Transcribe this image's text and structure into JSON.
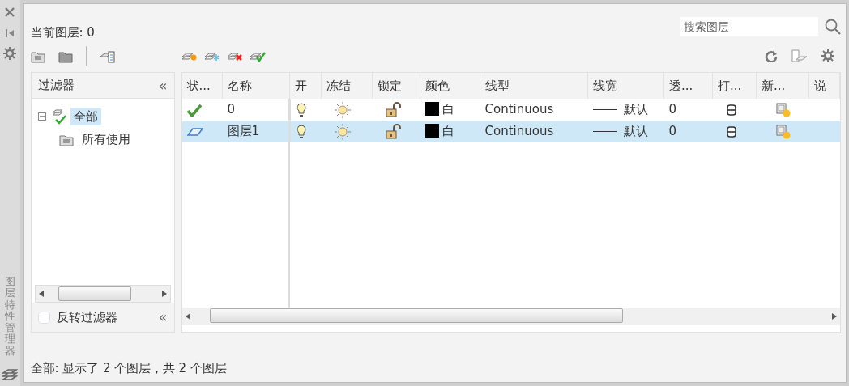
{
  "side_title": "图层特性管理器",
  "header": {
    "current_layer": "当前图层: 0"
  },
  "search": {
    "placeholder": "搜索图层"
  },
  "filter_panel": {
    "title": "过滤器",
    "collapse": "«",
    "tree": [
      {
        "label": "全部",
        "selected": true,
        "expanded": true,
        "children": [
          {
            "label": "所有使用",
            "selected": false
          }
        ]
      }
    ],
    "invert": {
      "label": "反转过滤器",
      "checked": false
    },
    "collapse_bottom": "«"
  },
  "table": {
    "columns": [
      "状...",
      "名称",
      "开",
      "冻结",
      "锁定",
      "颜色",
      "线型",
      "线宽",
      "透...",
      "打...",
      "新...",
      "说"
    ],
    "rows": [
      {
        "current": true,
        "name": "0",
        "on": true,
        "frozen": false,
        "locked": false,
        "color": "#000000",
        "color_name": "白",
        "linetype": "Continuous",
        "lineweight": "默认",
        "transparency": "0",
        "plot": true,
        "vp_frozen": false,
        "selected": false
      },
      {
        "current": false,
        "name": "图层1",
        "on": true,
        "frozen": false,
        "locked": false,
        "color": "#000000",
        "color_name": "白",
        "linetype": "Continuous",
        "lineweight": "默认",
        "transparency": "0",
        "plot": true,
        "vp_frozen": false,
        "selected": true
      }
    ]
  },
  "status_bar": "全部: 显示了 2 个图层 , 共 2 个图层"
}
